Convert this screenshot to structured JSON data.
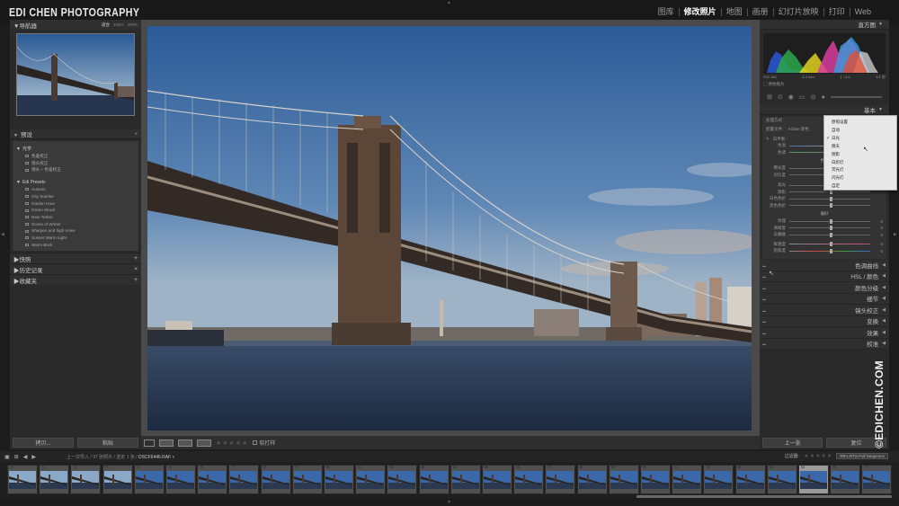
{
  "brand": "EDI CHEN PHOTOGRAPHY",
  "modules": [
    {
      "label": "图库",
      "active": false
    },
    {
      "label": "修改照片",
      "active": true
    },
    {
      "label": "地图",
      "active": false
    },
    {
      "label": "画册",
      "active": false
    },
    {
      "label": "幻灯片放映",
      "active": false
    },
    {
      "label": "打印",
      "active": false
    },
    {
      "label": "Web",
      "active": false
    }
  ],
  "navigator": {
    "title": "导航器",
    "zoom": [
      "适合",
      "100%",
      "200%"
    ]
  },
  "presets": {
    "title": "预设",
    "folders": [
      {
        "name": "光学",
        "items": [
          "色差校正",
          "镜头校正",
          "镜头 + 色差校正"
        ]
      },
      {
        "name": "Edi Presets",
        "items": [
          "Autumn",
          "City Sunrise",
          "Golden Hour",
          "Green Wood",
          "New Yorker",
          "Scene of Winter",
          "Sharpen and high noise",
          "Sunset Warm Light",
          "Warm Brick"
        ]
      }
    ]
  },
  "left_sections": [
    "快照",
    "历史记录",
    "收藏夹"
  ],
  "left_buttons": {
    "copy": "拷贝...",
    "paste": "粘贴"
  },
  "toolbar": {
    "stars": "★★★★★",
    "soft_proof": "软打样"
  },
  "histogram": {
    "title": "直方图",
    "info": [
      "ISO 160",
      "5.4 mm",
      "ƒ / 4.0",
      "1/1 秒"
    ],
    "original": "原始照片"
  },
  "basic": {
    "title": "基本",
    "treatment_label": "处理方式 :",
    "treatment_opts": [
      "彩色",
      "黑白"
    ],
    "profile_label": "配置文件 :",
    "profile_value": "Adobe 颜色",
    "wb_label": "白平衡 :",
    "tone_sub": "色调",
    "presence_sub": "偏好",
    "wb_rows": [
      {
        "label": "色温",
        "pos": 0.55,
        "value": ""
      },
      {
        "label": "色调",
        "pos": 0.5,
        "value": ""
      }
    ],
    "tone_rows": [
      {
        "label": "曝光度",
        "pos": 0.5,
        "value": ""
      },
      {
        "label": "对比度",
        "pos": 0.5,
        "value": ""
      },
      {
        "label": "高光",
        "pos": 0.5,
        "value": ""
      },
      {
        "label": "阴影",
        "pos": 0.5,
        "value": ""
      },
      {
        "label": "白色色阶",
        "pos": 0.5,
        "value": ""
      },
      {
        "label": "黑色色阶",
        "pos": 0.5,
        "value": ""
      }
    ],
    "presence_rows": [
      {
        "label": "纹理",
        "pos": 0.5,
        "value": "0"
      },
      {
        "label": "清晰度",
        "pos": 0.5,
        "value": "0"
      },
      {
        "label": "去朦胧",
        "pos": 0.5,
        "value": "0"
      },
      {
        "label": "鲜艳度",
        "pos": 0.5,
        "value": "0"
      },
      {
        "label": "饱和度",
        "pos": 0.5,
        "value": "0"
      }
    ]
  },
  "wb_menu": [
    {
      "label": "原照设置",
      "sel": false
    },
    {
      "label": "自动",
      "sel": false
    },
    {
      "label": "日光",
      "sel": true
    },
    {
      "label": "阴天",
      "sel": false
    },
    {
      "label": "阴影",
      "sel": false
    },
    {
      "label": "白炽灯",
      "sel": false
    },
    {
      "label": "荧光灯",
      "sel": false
    },
    {
      "label": "闪光灯",
      "sel": false
    },
    {
      "label": "自定",
      "sel": false
    }
  ],
  "right_sections": [
    "色调曲线",
    "HSL / 颜色",
    "颜色分级",
    "细节",
    "镜头校正",
    "变换",
    "效果",
    "校准"
  ],
  "right_buttons": {
    "prev": "上一张",
    "reset": "复位"
  },
  "watermark": "©EDICHEN.COM",
  "filmbar": {
    "info_prefix": "上一次导入",
    "info_count": "97 张照片 / 选定 1 张 /",
    "filename": "DSCF6446.RAF",
    "filter_label": "过滤器 :",
    "filter_value": "RR-LRTS-Full Sequence"
  },
  "film_numbers": [
    "70",
    "71",
    "72",
    "73",
    "74",
    "75",
    "76",
    "77",
    "78",
    "79",
    "80",
    "81",
    "82",
    "83",
    "84",
    "85",
    "86",
    "87",
    "88",
    "89",
    "90",
    "91",
    "92",
    "93",
    "94",
    "95",
    "96",
    "97"
  ],
  "active_frame": 25,
  "colors": {
    "sky_top": "#2f5f9a",
    "sky_bottom": "#8ea9c4",
    "water": "#283852",
    "bridge": "#3a2f2a"
  }
}
